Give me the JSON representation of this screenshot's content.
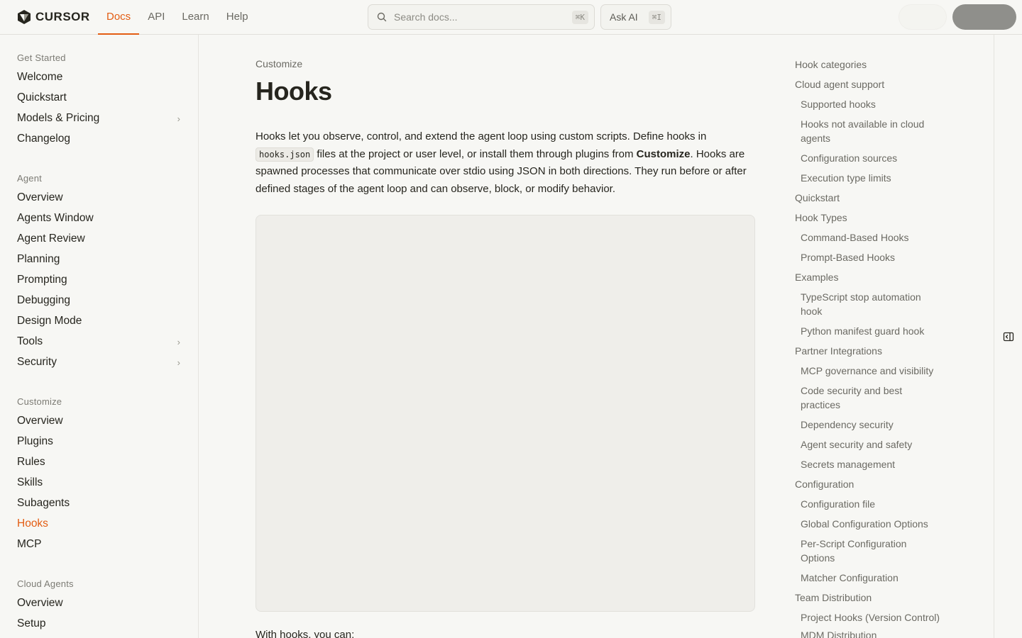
{
  "brand": {
    "name": "CURSOR"
  },
  "topnav": {
    "items": [
      {
        "label": "Docs",
        "active": true
      },
      {
        "label": "API"
      },
      {
        "label": "Learn"
      },
      {
        "label": "Help"
      }
    ]
  },
  "search": {
    "placeholder": "Search docs...",
    "shortcut": "⌘K"
  },
  "askai": {
    "label": "Ask AI",
    "shortcut": "⌘I"
  },
  "sidebar": {
    "sections": [
      {
        "title": "Get Started",
        "items": [
          {
            "label": "Welcome"
          },
          {
            "label": "Quickstart"
          },
          {
            "label": "Models & Pricing",
            "expandable": true
          },
          {
            "label": "Changelog"
          }
        ]
      },
      {
        "title": "Agent",
        "items": [
          {
            "label": "Overview"
          },
          {
            "label": "Agents Window"
          },
          {
            "label": "Agent Review"
          },
          {
            "label": "Planning"
          },
          {
            "label": "Prompting"
          },
          {
            "label": "Debugging"
          },
          {
            "label": "Design Mode"
          },
          {
            "label": "Tools",
            "expandable": true
          },
          {
            "label": "Security",
            "expandable": true
          }
        ]
      },
      {
        "title": "Customize",
        "items": [
          {
            "label": "Overview"
          },
          {
            "label": "Plugins"
          },
          {
            "label": "Rules"
          },
          {
            "label": "Skills"
          },
          {
            "label": "Subagents"
          },
          {
            "label": "Hooks",
            "active": true
          },
          {
            "label": "MCP"
          }
        ]
      },
      {
        "title": "Cloud Agents",
        "items": [
          {
            "label": "Overview"
          },
          {
            "label": "Setup"
          }
        ]
      }
    ]
  },
  "main": {
    "breadcrumb": "Customize",
    "title": "Hooks",
    "intro": {
      "p1": "Hooks let you observe, control, and extend the agent loop using custom scripts. Define hooks in ",
      "code": "hooks.json",
      "p2": " files at the project or user level, or install them through plugins from ",
      "bold": "Customize",
      "p3": ". Hooks are spawned processes that communicate over stdio using JSON in both directions. They run before or after defined stages of the agent loop and can observe, block, or modify behavior."
    },
    "lead": "With hooks, you can:"
  },
  "toc": {
    "items": [
      {
        "label": "Hook categories",
        "level": 1
      },
      {
        "label": "Cloud agent support",
        "level": 1
      },
      {
        "label": "Supported hooks",
        "level": 2
      },
      {
        "label": "Hooks not available in cloud agents",
        "level": 2
      },
      {
        "label": "Configuration sources",
        "level": 2
      },
      {
        "label": "Execution type limits",
        "level": 2
      },
      {
        "label": "Quickstart",
        "level": 1
      },
      {
        "label": "Hook Types",
        "level": 1
      },
      {
        "label": "Command-Based Hooks",
        "level": 2
      },
      {
        "label": "Prompt-Based Hooks",
        "level": 2
      },
      {
        "label": "Examples",
        "level": 1
      },
      {
        "label": "TypeScript stop automation hook",
        "level": 2
      },
      {
        "label": "Python manifest guard hook",
        "level": 2
      },
      {
        "label": "Partner Integrations",
        "level": 1
      },
      {
        "label": "MCP governance and visibility",
        "level": 2
      },
      {
        "label": "Code security and best practices",
        "level": 2
      },
      {
        "label": "Dependency security",
        "level": 2
      },
      {
        "label": "Agent security and safety",
        "level": 2
      },
      {
        "label": "Secrets management",
        "level": 2
      },
      {
        "label": "Configuration",
        "level": 1
      },
      {
        "label": "Configuration file",
        "level": 2
      },
      {
        "label": "Global Configuration Options",
        "level": 2
      },
      {
        "label": "Per-Script Configuration Options",
        "level": 2
      },
      {
        "label": "Matcher Configuration",
        "level": 2
      },
      {
        "label": "Team Distribution",
        "level": 1
      },
      {
        "label": "Project Hooks (Version Control)",
        "level": 2
      },
      {
        "label": "MDM Distribution",
        "level": 2
      }
    ]
  },
  "colors": {
    "accent": "#e35d13",
    "text": "#26251e",
    "muted": "#6b6a63",
    "background": "#f7f7f4"
  }
}
